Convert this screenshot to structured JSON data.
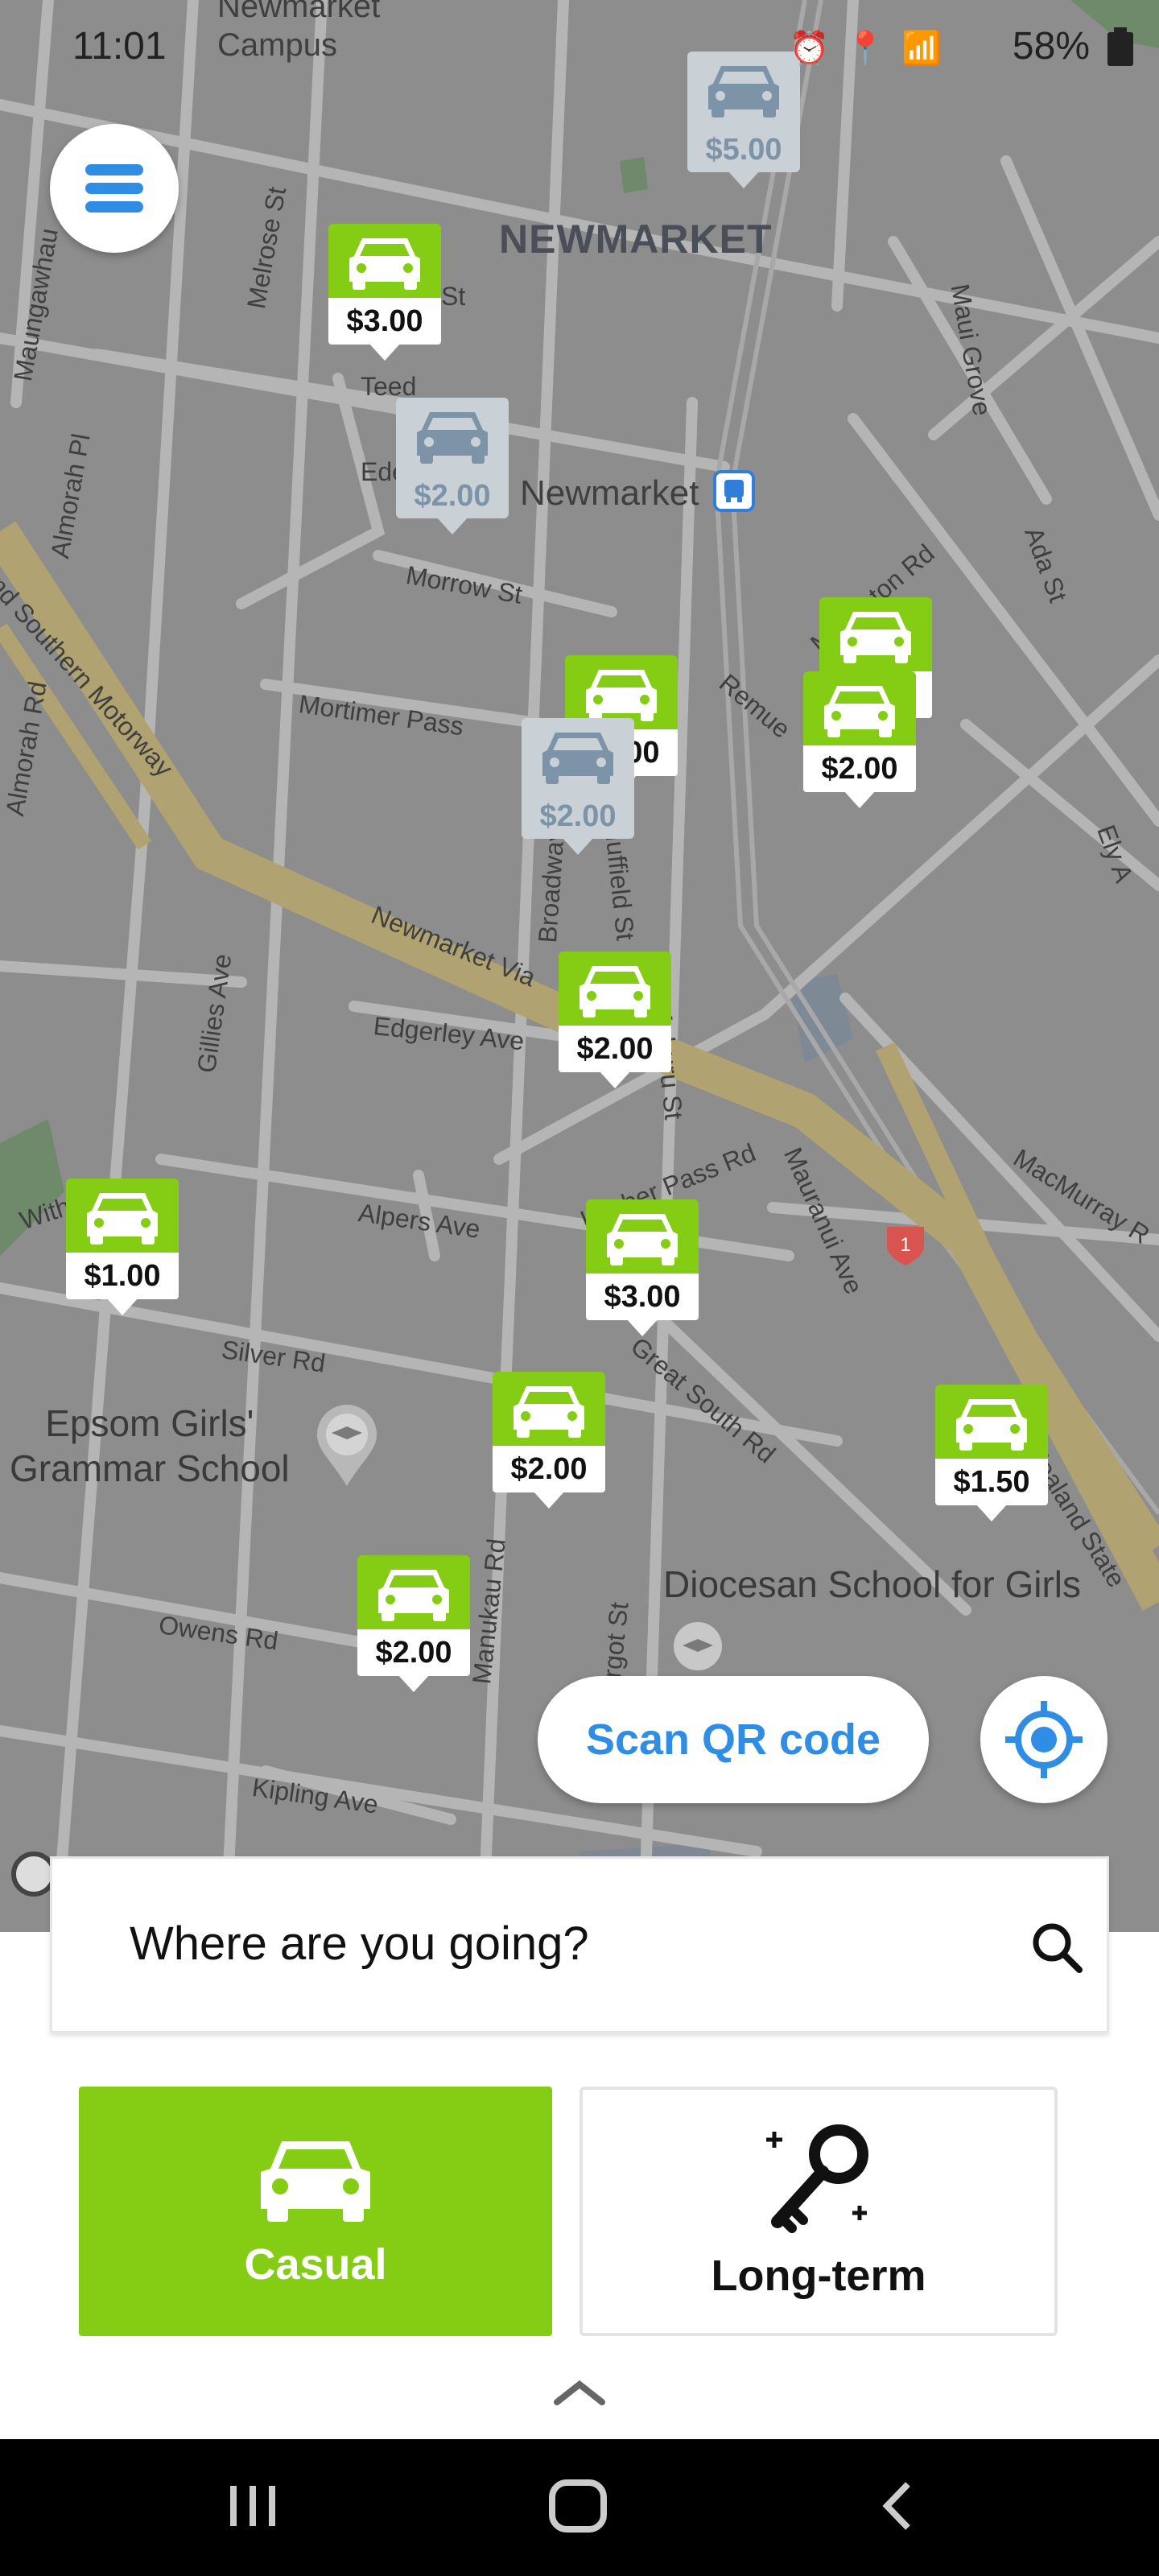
{
  "status_bar": {
    "time": "11:01",
    "battery": "58%",
    "icons": [
      "alarm-icon",
      "location-icon",
      "wifi-icon",
      "signal-icon",
      "battery-icon"
    ]
  },
  "map": {
    "labels": {
      "newmarket_top": "Newmarket",
      "campus": "Campus",
      "newmarket_area": "NEWMARKET",
      "newmarket_station": "Newmarket",
      "melrose_st": "Melrose St",
      "st_short": "St",
      "teed": "Teed",
      "ede": "Ede",
      "maungawhau": "Maungawhau",
      "almorah_pl": "Almorah Pl",
      "almorah_rd": "Almorah Rd",
      "southern_motorway": "land Southern Motorway",
      "morrow_st": "Morrow St",
      "mortimer_pass": "Mortimer Pass",
      "remuera": "Remue",
      "middleton_rd": "Middleton Rd",
      "maui_grove": "Maui Grove",
      "ada_st": "Ada St",
      "ely": "Ely A",
      "newmarket_viaduct": "Newmarket Via",
      "broadway": "Broadway",
      "nuffield_st": "Nuffield St",
      "gillies_ave": "Gillies Ave",
      "edgerley_ave": "Edgerley Ave",
      "mahuru_st": "Mahuru St",
      "alpers_ave": "Alpers Ave",
      "khyber_pass": "Khyber Pass Rd",
      "with": "With",
      "mauranui_ave": "Mauranui Ave",
      "macmurray": "MacMurray R",
      "silver_rd": "Silver Rd",
      "epsom_girls": "Epsom Girls'\nGrammar School",
      "great_south_rd": "Great South Rd",
      "nz_state": "Zealand State",
      "diocesan": "Diocesan School for Girls",
      "owens_rd": "Owens Rd",
      "manukau_rd": "Manukau Rd",
      "margot_st": "argot St",
      "kipling_ave": "Kipling Ave",
      "route_shield": "1"
    },
    "markers": [
      {
        "price": "$5.00",
        "state": "inactive"
      },
      {
        "price": "$3.00",
        "state": "active"
      },
      {
        "price": "$2.00",
        "state": "inactive"
      },
      {
        "price": "$2.00",
        "state": "active"
      },
      {
        "price": "$2.00",
        "state": "inactive"
      },
      {
        "price": "$3.00",
        "state": "active"
      },
      {
        "price": "$2.00",
        "state": "active"
      },
      {
        "price": "$2.00",
        "state": "active"
      },
      {
        "price": "$1.00",
        "state": "active"
      },
      {
        "price": "$3.00",
        "state": "active"
      },
      {
        "price": "$2.00",
        "state": "active"
      },
      {
        "price": "$1.50",
        "state": "active"
      },
      {
        "price": "$2.00",
        "state": "active"
      }
    ]
  },
  "actions": {
    "scan_qr": "Scan QR code"
  },
  "search": {
    "placeholder": "Where are you going?"
  },
  "modes": {
    "casual": "Casual",
    "longterm": "Long-term"
  },
  "colors": {
    "accent_green": "#85cc14",
    "accent_blue": "#2f8de4",
    "map_gray": "#8d8d8d"
  }
}
